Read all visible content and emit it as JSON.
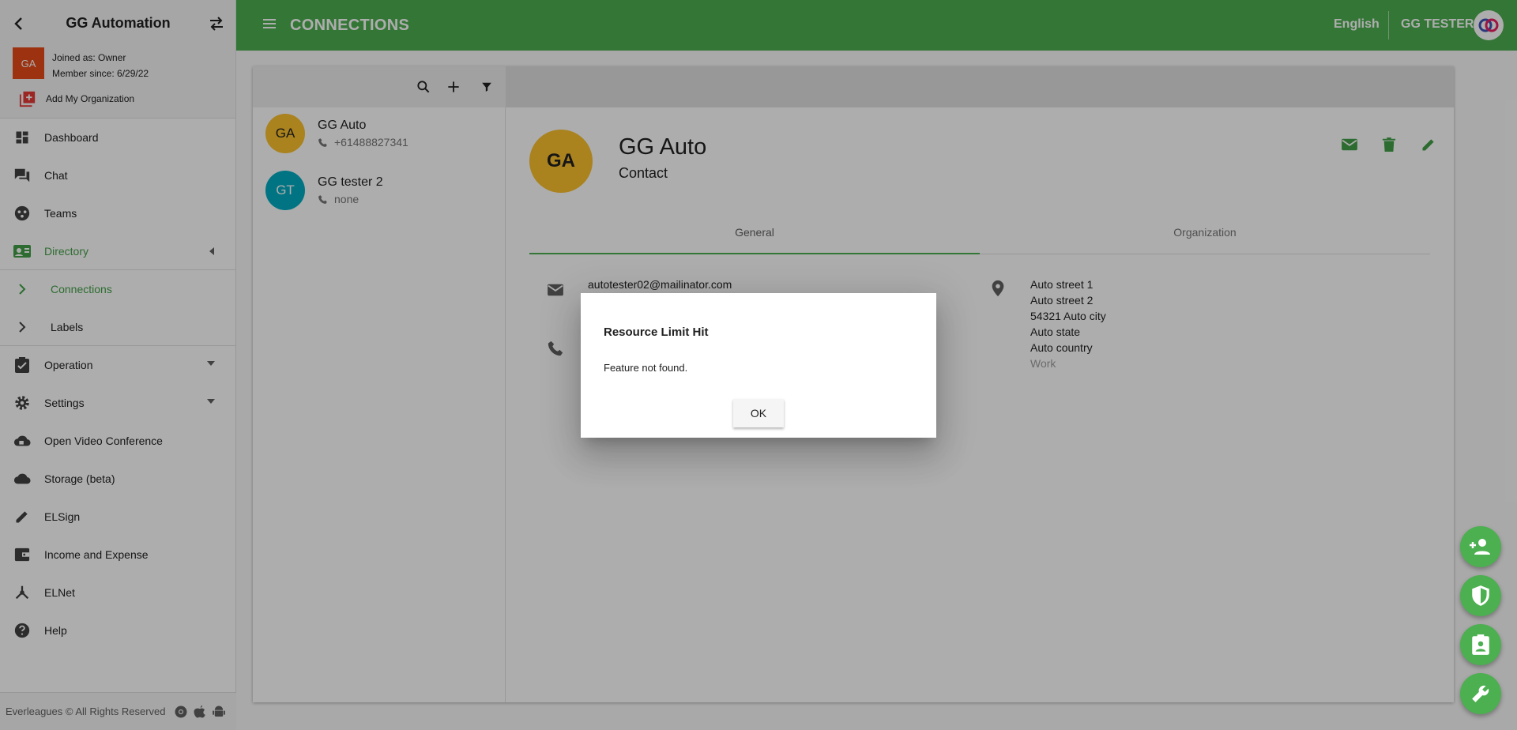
{
  "sidebar": {
    "org_name": "GG Automation",
    "org_initials": "GA",
    "joined_as": "Joined as: Owner",
    "member_since": "Member since: 6/29/22",
    "add_org": "Add My Organization",
    "items": [
      {
        "label": "Dashboard"
      },
      {
        "label": "Chat"
      },
      {
        "label": "Teams"
      },
      {
        "label": "Directory"
      },
      {
        "label": "Connections"
      },
      {
        "label": "Labels"
      },
      {
        "label": "Operation"
      },
      {
        "label": "Settings"
      },
      {
        "label": "Open Video Conference"
      },
      {
        "label": "Storage (beta)"
      },
      {
        "label": "ELSign"
      },
      {
        "label": "Income and Expense"
      },
      {
        "label": "ELNet"
      },
      {
        "label": "Help"
      }
    ],
    "footer": "Everleagues © All Rights Reserved"
  },
  "topbar": {
    "title": "CONNECTIONS",
    "language": "English",
    "user": "GG TESTER"
  },
  "contacts": [
    {
      "initials": "GA",
      "name": "GG Auto",
      "phone": "+61488827341",
      "color": "#fbc02d"
    },
    {
      "initials": "GT",
      "name": "GG tester 2",
      "phone": "none",
      "color": "#00acc1"
    }
  ],
  "detail": {
    "initials": "GA",
    "name": "GG Auto",
    "type": "Contact",
    "tabs": [
      {
        "label": "General"
      },
      {
        "label": "Organization"
      }
    ],
    "email": "autotester02@mailinator.com",
    "address": [
      "Auto street 1",
      "Auto street 2",
      "54321 Auto city",
      "Auto state",
      "Auto country"
    ],
    "address_type": "Work"
  },
  "dialog": {
    "title": "Resource Limit Hit",
    "message": "Feature not found.",
    "ok_label": "OK"
  },
  "colors": {
    "primary": "#4caf50",
    "active_nav": "#43a047",
    "org_avatar": "#e64a19"
  }
}
